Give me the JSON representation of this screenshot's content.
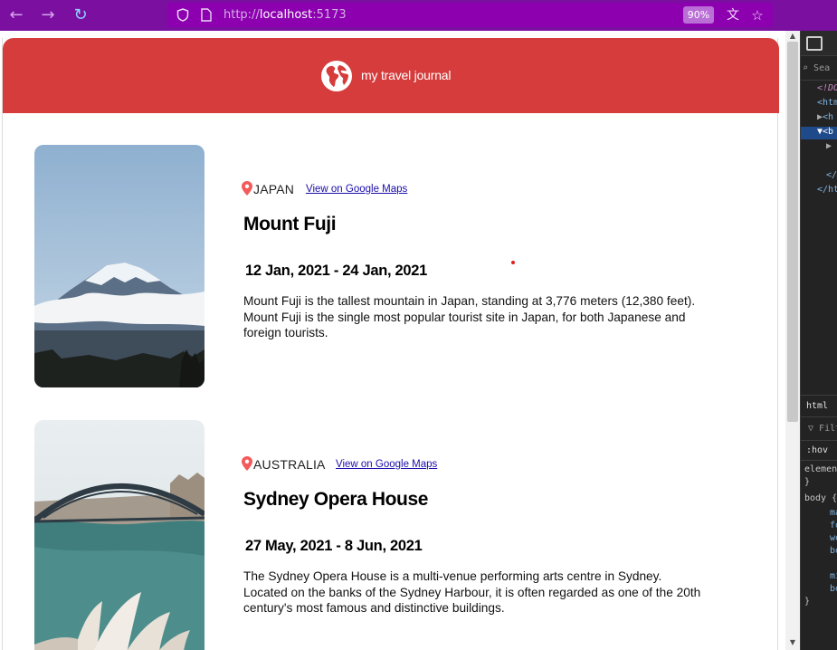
{
  "browser": {
    "url_scheme": "http://",
    "url_host": "localhost",
    "url_port": ":5173",
    "zoom": "90%"
  },
  "app": {
    "brand": "my travel journal"
  },
  "entries": [
    {
      "country": "JAPAN",
      "map_link": "View on Google Maps",
      "title": "Mount Fuji",
      "dates": "12 Jan, 2021 - 24 Jan, 2021",
      "description": "Mount Fuji is the tallest mountain in Japan, standing at 3,776 meters (12,380 feet). Mount Fuji is the single most popular tourist site in Japan, for both Japanese and foreign tourists."
    },
    {
      "country": "AUSTRALIA",
      "map_link": "View on Google Maps",
      "title": "Sydney Opera House",
      "dates": "27 May, 2021 - 8 Jun, 2021",
      "description": "The Sydney Opera House is a multi-venue performing arts centre in Sydney. Located on the banks of the Sydney Harbour, it is often regarded as one of the 20th century's most famous and distinctive buildings."
    }
  ],
  "devtools": {
    "search": "Sea",
    "dom_lines": [
      "<!DO",
      "<htm",
      "<h",
      "<b",
      "",
      "</",
      "</ht"
    ],
    "tab_html": "html",
    "filter": "Filt",
    "hov": ":hov",
    "rules": [
      "elemen",
      "}",
      "body {",
      "ma",
      "fo",
      "wo",
      "bo",
      "",
      "mi",
      "bo",
      "}"
    ]
  },
  "colors": {
    "toolbar": "#7a0fa0",
    "header": "#d63c3c",
    "link": "#1a0dab",
    "pin": "#f55a5a"
  }
}
